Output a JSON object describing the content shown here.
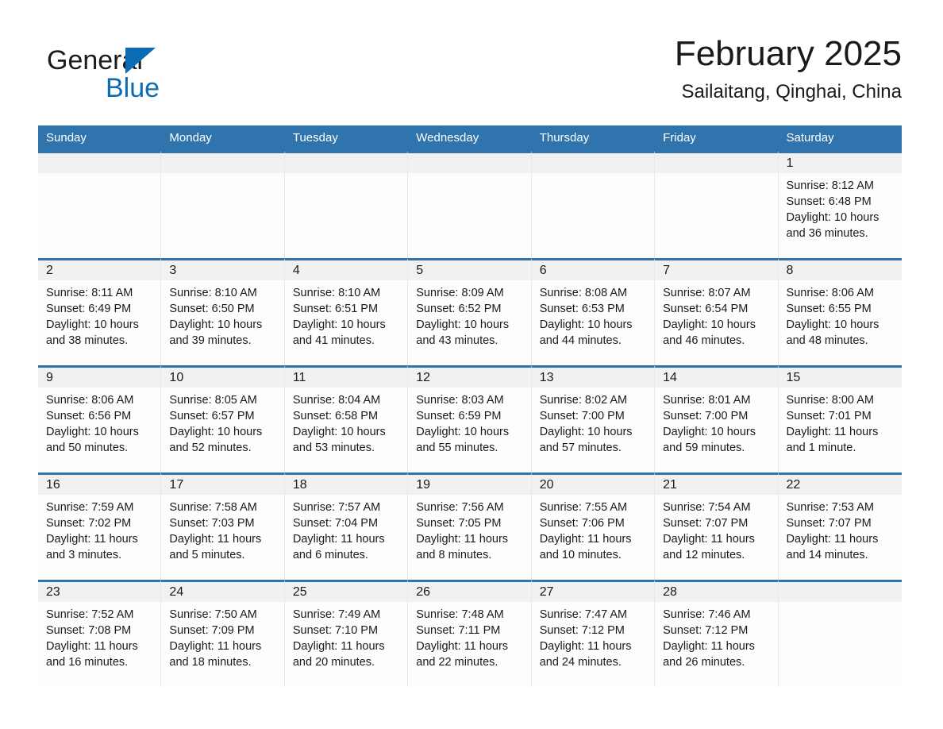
{
  "brand": {
    "name_part1": "General",
    "name_part2": "Blue",
    "accent_color": "#0b6cb5",
    "triangle_icon": "triangle-icon"
  },
  "header": {
    "title": "February 2025",
    "subtitle": "Sailaitang, Qinghai, China"
  },
  "theme": {
    "header_blue": "#3074ae",
    "daynum_band": "#f1f1f1",
    "cell_bg": "#fdfdfd",
    "text": "#1a1a1a"
  },
  "weekdays": [
    "Sunday",
    "Monday",
    "Tuesday",
    "Wednesday",
    "Thursday",
    "Friday",
    "Saturday"
  ],
  "labels": {
    "sunrise_prefix": "Sunrise:",
    "sunset_prefix": "Sunset:",
    "daylight_prefix": "Daylight:"
  },
  "weeks": [
    [
      {
        "day": "",
        "empty": true
      },
      {
        "day": "",
        "empty": true
      },
      {
        "day": "",
        "empty": true
      },
      {
        "day": "",
        "empty": true
      },
      {
        "day": "",
        "empty": true
      },
      {
        "day": "",
        "empty": true
      },
      {
        "day": "1",
        "sunrise": "Sunrise: 8:12 AM",
        "sunset": "Sunset: 6:48 PM",
        "daylight": "Daylight: 10 hours and 36 minutes."
      }
    ],
    [
      {
        "day": "2",
        "sunrise": "Sunrise: 8:11 AM",
        "sunset": "Sunset: 6:49 PM",
        "daylight": "Daylight: 10 hours and 38 minutes."
      },
      {
        "day": "3",
        "sunrise": "Sunrise: 8:10 AM",
        "sunset": "Sunset: 6:50 PM",
        "daylight": "Daylight: 10 hours and 39 minutes."
      },
      {
        "day": "4",
        "sunrise": "Sunrise: 8:10 AM",
        "sunset": "Sunset: 6:51 PM",
        "daylight": "Daylight: 10 hours and 41 minutes."
      },
      {
        "day": "5",
        "sunrise": "Sunrise: 8:09 AM",
        "sunset": "Sunset: 6:52 PM",
        "daylight": "Daylight: 10 hours and 43 minutes."
      },
      {
        "day": "6",
        "sunrise": "Sunrise: 8:08 AM",
        "sunset": "Sunset: 6:53 PM",
        "daylight": "Daylight: 10 hours and 44 minutes."
      },
      {
        "day": "7",
        "sunrise": "Sunrise: 8:07 AM",
        "sunset": "Sunset: 6:54 PM",
        "daylight": "Daylight: 10 hours and 46 minutes."
      },
      {
        "day": "8",
        "sunrise": "Sunrise: 8:06 AM",
        "sunset": "Sunset: 6:55 PM",
        "daylight": "Daylight: 10 hours and 48 minutes."
      }
    ],
    [
      {
        "day": "9",
        "sunrise": "Sunrise: 8:06 AM",
        "sunset": "Sunset: 6:56 PM",
        "daylight": "Daylight: 10 hours and 50 minutes."
      },
      {
        "day": "10",
        "sunrise": "Sunrise: 8:05 AM",
        "sunset": "Sunset: 6:57 PM",
        "daylight": "Daylight: 10 hours and 52 minutes."
      },
      {
        "day": "11",
        "sunrise": "Sunrise: 8:04 AM",
        "sunset": "Sunset: 6:58 PM",
        "daylight": "Daylight: 10 hours and 53 minutes."
      },
      {
        "day": "12",
        "sunrise": "Sunrise: 8:03 AM",
        "sunset": "Sunset: 6:59 PM",
        "daylight": "Daylight: 10 hours and 55 minutes."
      },
      {
        "day": "13",
        "sunrise": "Sunrise: 8:02 AM",
        "sunset": "Sunset: 7:00 PM",
        "daylight": "Daylight: 10 hours and 57 minutes."
      },
      {
        "day": "14",
        "sunrise": "Sunrise: 8:01 AM",
        "sunset": "Sunset: 7:00 PM",
        "daylight": "Daylight: 10 hours and 59 minutes."
      },
      {
        "day": "15",
        "sunrise": "Sunrise: 8:00 AM",
        "sunset": "Sunset: 7:01 PM",
        "daylight": "Daylight: 11 hours and 1 minute."
      }
    ],
    [
      {
        "day": "16",
        "sunrise": "Sunrise: 7:59 AM",
        "sunset": "Sunset: 7:02 PM",
        "daylight": "Daylight: 11 hours and 3 minutes."
      },
      {
        "day": "17",
        "sunrise": "Sunrise: 7:58 AM",
        "sunset": "Sunset: 7:03 PM",
        "daylight": "Daylight: 11 hours and 5 minutes."
      },
      {
        "day": "18",
        "sunrise": "Sunrise: 7:57 AM",
        "sunset": "Sunset: 7:04 PM",
        "daylight": "Daylight: 11 hours and 6 minutes."
      },
      {
        "day": "19",
        "sunrise": "Sunrise: 7:56 AM",
        "sunset": "Sunset: 7:05 PM",
        "daylight": "Daylight: 11 hours and 8 minutes."
      },
      {
        "day": "20",
        "sunrise": "Sunrise: 7:55 AM",
        "sunset": "Sunset: 7:06 PM",
        "daylight": "Daylight: 11 hours and 10 minutes."
      },
      {
        "day": "21",
        "sunrise": "Sunrise: 7:54 AM",
        "sunset": "Sunset: 7:07 PM",
        "daylight": "Daylight: 11 hours and 12 minutes."
      },
      {
        "day": "22",
        "sunrise": "Sunrise: 7:53 AM",
        "sunset": "Sunset: 7:07 PM",
        "daylight": "Daylight: 11 hours and 14 minutes."
      }
    ],
    [
      {
        "day": "23",
        "sunrise": "Sunrise: 7:52 AM",
        "sunset": "Sunset: 7:08 PM",
        "daylight": "Daylight: 11 hours and 16 minutes."
      },
      {
        "day": "24",
        "sunrise": "Sunrise: 7:50 AM",
        "sunset": "Sunset: 7:09 PM",
        "daylight": "Daylight: 11 hours and 18 minutes."
      },
      {
        "day": "25",
        "sunrise": "Sunrise: 7:49 AM",
        "sunset": "Sunset: 7:10 PM",
        "daylight": "Daylight: 11 hours and 20 minutes."
      },
      {
        "day": "26",
        "sunrise": "Sunrise: 7:48 AM",
        "sunset": "Sunset: 7:11 PM",
        "daylight": "Daylight: 11 hours and 22 minutes."
      },
      {
        "day": "27",
        "sunrise": "Sunrise: 7:47 AM",
        "sunset": "Sunset: 7:12 PM",
        "daylight": "Daylight: 11 hours and 24 minutes."
      },
      {
        "day": "28",
        "sunrise": "Sunrise: 7:46 AM",
        "sunset": "Sunset: 7:12 PM",
        "daylight": "Daylight: 11 hours and 26 minutes."
      },
      {
        "day": "",
        "empty": true
      }
    ]
  ]
}
